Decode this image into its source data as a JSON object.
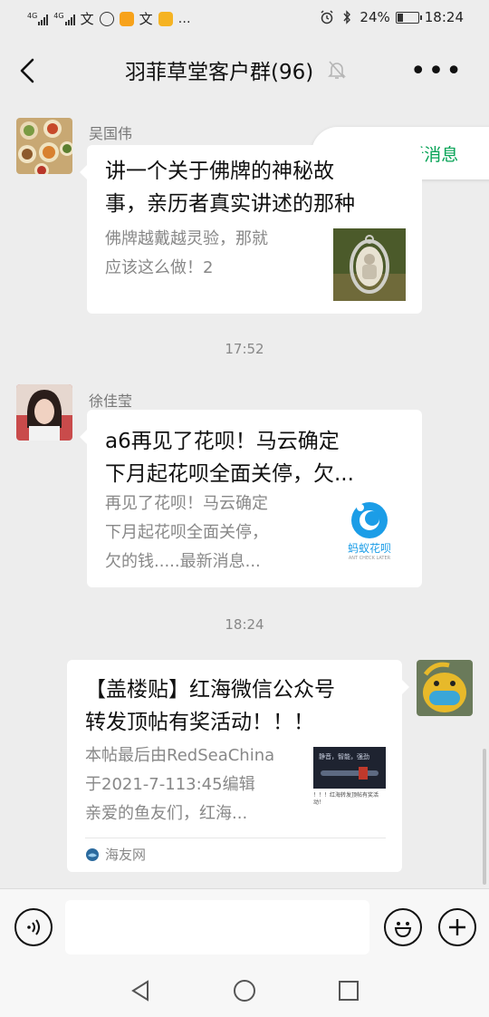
{
  "status_bar": {
    "network_left_1": "4G",
    "network_left_2": "4G",
    "battery": "24%",
    "time": "18:24",
    "more": "…"
  },
  "header": {
    "title": "羽菲草堂客户群(96)"
  },
  "new_messages_chip": {
    "label": "125条新消息",
    "chevron": "︽"
  },
  "messages": [
    {
      "sender": "吴国伟",
      "title_line1": "讲一个关于佛牌的神秘故",
      "title_line2": "事，亲历者真实讲述的那种",
      "desc_line1": "佛牌越戴越灵验，那就",
      "desc_line2": "应该这么做！2"
    },
    {
      "time": "17:52"
    },
    {
      "sender": "徐佳莹",
      "title_line1": "a6再见了花呗！马云确定",
      "title_line2": "下月起花呗全面关停，欠...",
      "desc_line1": "再见了花呗！马云确定",
      "desc_line2": "下月起花呗全面关停，",
      "desc_line3": "欠的钱.....最新消息...",
      "thumb_logo_cn": "蚂蚁花呗",
      "thumb_logo_en": "ANT CHECK LATER"
    },
    {
      "time": "18:24"
    },
    {
      "title_line1": "【盖楼贴】红海微信公众号",
      "title_line2": "转发顶帖有奖活动！！！",
      "desc_line1": "本帖最后由RedSeaChina",
      "desc_line2": "于2021-7-113:45编辑",
      "desc_line3": "亲爱的鱼友们，红海...",
      "thumb_caption": "！！！红海转发顶帖有奖活动！",
      "thumb_banner": "静音，智能，强劲",
      "source": "海友网"
    }
  ],
  "colors": {
    "background": "#ededed",
    "accent_green": "#07a356",
    "card": "#ffffff",
    "muted_text": "#888888"
  },
  "icons": {
    "back": "chevron-left-icon",
    "mute": "bell-off-icon",
    "more": "more-dots-icon",
    "voice": "voice-icon",
    "emoji": "smiley-icon",
    "plus": "plus-icon",
    "nav_back": "triangle-back-icon",
    "nav_home": "circle-home-icon",
    "nav_recent": "square-recent-icon"
  }
}
